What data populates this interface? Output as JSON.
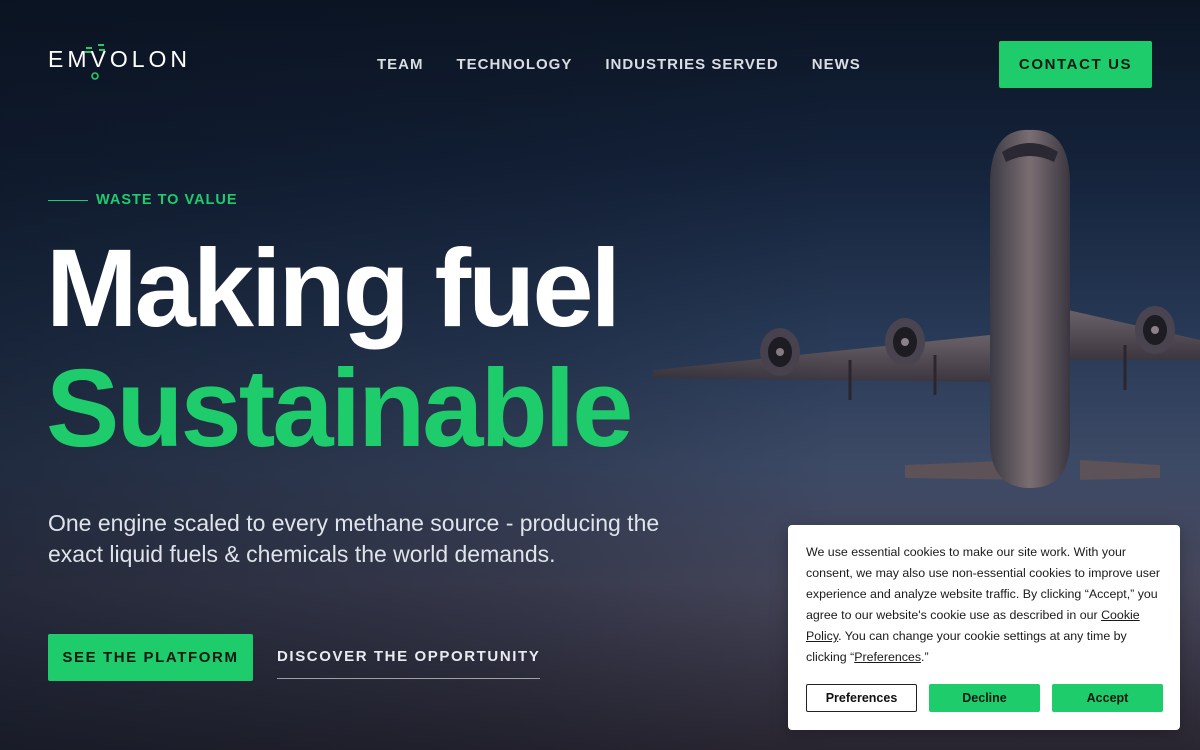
{
  "brand": {
    "logo_text": "EMVOLON",
    "accent_color": "#1fcc6b",
    "icon": "emvolon-logo-mark"
  },
  "nav": {
    "items": [
      {
        "label": "TEAM"
      },
      {
        "label": "TECHNOLOGY"
      },
      {
        "label": "INDUSTRIES SERVED"
      },
      {
        "label": "NEWS"
      }
    ],
    "contact_label": "CONTACT US"
  },
  "hero": {
    "eyebrow": "WASTE TO VALUE",
    "title_line1": "Making fuel",
    "title_line2": "Sustainable",
    "subtitle": "One engine scaled to every methane source - producing the exact liquid fuels & chemicals the world demands.",
    "primary_cta": "SEE THE PLATFORM",
    "secondary_cta": "DISCOVER THE OPPORTUNITY",
    "background_image": "airplane-taking-off-at-dusk"
  },
  "cookie": {
    "text_before_link": "We use essential cookies to make our site work. With your consent, we may also use non-essential cookies to improve user experience and analyze website traffic. By clicking “Accept,” you agree to our website's cookie use as described in our ",
    "policy_link": "Cookie Policy",
    "text_middle": ". You can change your cookie settings at any time by clicking “",
    "preferences_link": "Preferences",
    "text_end": ".”",
    "buttons": {
      "preferences": "Preferences",
      "decline": "Decline",
      "accept": "Accept"
    }
  }
}
